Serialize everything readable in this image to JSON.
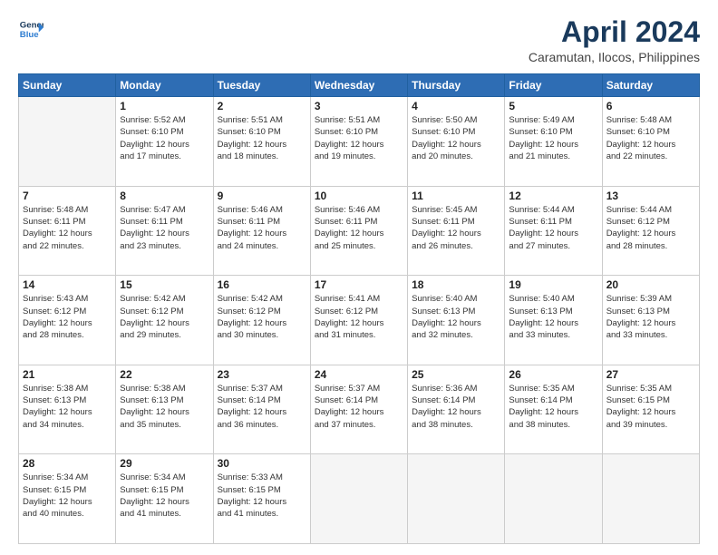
{
  "logo": {
    "line1": "General",
    "line2": "Blue"
  },
  "title": "April 2024",
  "location": "Caramutan, Ilocos, Philippines",
  "days_header": [
    "Sunday",
    "Monday",
    "Tuesday",
    "Wednesday",
    "Thursday",
    "Friday",
    "Saturday"
  ],
  "weeks": [
    [
      {
        "day": "",
        "info": ""
      },
      {
        "day": "1",
        "info": "Sunrise: 5:52 AM\nSunset: 6:10 PM\nDaylight: 12 hours\nand 17 minutes."
      },
      {
        "day": "2",
        "info": "Sunrise: 5:51 AM\nSunset: 6:10 PM\nDaylight: 12 hours\nand 18 minutes."
      },
      {
        "day": "3",
        "info": "Sunrise: 5:51 AM\nSunset: 6:10 PM\nDaylight: 12 hours\nand 19 minutes."
      },
      {
        "day": "4",
        "info": "Sunrise: 5:50 AM\nSunset: 6:10 PM\nDaylight: 12 hours\nand 20 minutes."
      },
      {
        "day": "5",
        "info": "Sunrise: 5:49 AM\nSunset: 6:10 PM\nDaylight: 12 hours\nand 21 minutes."
      },
      {
        "day": "6",
        "info": "Sunrise: 5:48 AM\nSunset: 6:10 PM\nDaylight: 12 hours\nand 22 minutes."
      }
    ],
    [
      {
        "day": "7",
        "info": "Sunrise: 5:48 AM\nSunset: 6:11 PM\nDaylight: 12 hours\nand 22 minutes."
      },
      {
        "day": "8",
        "info": "Sunrise: 5:47 AM\nSunset: 6:11 PM\nDaylight: 12 hours\nand 23 minutes."
      },
      {
        "day": "9",
        "info": "Sunrise: 5:46 AM\nSunset: 6:11 PM\nDaylight: 12 hours\nand 24 minutes."
      },
      {
        "day": "10",
        "info": "Sunrise: 5:46 AM\nSunset: 6:11 PM\nDaylight: 12 hours\nand 25 minutes."
      },
      {
        "day": "11",
        "info": "Sunrise: 5:45 AM\nSunset: 6:11 PM\nDaylight: 12 hours\nand 26 minutes."
      },
      {
        "day": "12",
        "info": "Sunrise: 5:44 AM\nSunset: 6:11 PM\nDaylight: 12 hours\nand 27 minutes."
      },
      {
        "day": "13",
        "info": "Sunrise: 5:44 AM\nSunset: 6:12 PM\nDaylight: 12 hours\nand 28 minutes."
      }
    ],
    [
      {
        "day": "14",
        "info": "Sunrise: 5:43 AM\nSunset: 6:12 PM\nDaylight: 12 hours\nand 28 minutes."
      },
      {
        "day": "15",
        "info": "Sunrise: 5:42 AM\nSunset: 6:12 PM\nDaylight: 12 hours\nand 29 minutes."
      },
      {
        "day": "16",
        "info": "Sunrise: 5:42 AM\nSunset: 6:12 PM\nDaylight: 12 hours\nand 30 minutes."
      },
      {
        "day": "17",
        "info": "Sunrise: 5:41 AM\nSunset: 6:12 PM\nDaylight: 12 hours\nand 31 minutes."
      },
      {
        "day": "18",
        "info": "Sunrise: 5:40 AM\nSunset: 6:13 PM\nDaylight: 12 hours\nand 32 minutes."
      },
      {
        "day": "19",
        "info": "Sunrise: 5:40 AM\nSunset: 6:13 PM\nDaylight: 12 hours\nand 33 minutes."
      },
      {
        "day": "20",
        "info": "Sunrise: 5:39 AM\nSunset: 6:13 PM\nDaylight: 12 hours\nand 33 minutes."
      }
    ],
    [
      {
        "day": "21",
        "info": "Sunrise: 5:38 AM\nSunset: 6:13 PM\nDaylight: 12 hours\nand 34 minutes."
      },
      {
        "day": "22",
        "info": "Sunrise: 5:38 AM\nSunset: 6:13 PM\nDaylight: 12 hours\nand 35 minutes."
      },
      {
        "day": "23",
        "info": "Sunrise: 5:37 AM\nSunset: 6:14 PM\nDaylight: 12 hours\nand 36 minutes."
      },
      {
        "day": "24",
        "info": "Sunrise: 5:37 AM\nSunset: 6:14 PM\nDaylight: 12 hours\nand 37 minutes."
      },
      {
        "day": "25",
        "info": "Sunrise: 5:36 AM\nSunset: 6:14 PM\nDaylight: 12 hours\nand 38 minutes."
      },
      {
        "day": "26",
        "info": "Sunrise: 5:35 AM\nSunset: 6:14 PM\nDaylight: 12 hours\nand 38 minutes."
      },
      {
        "day": "27",
        "info": "Sunrise: 5:35 AM\nSunset: 6:15 PM\nDaylight: 12 hours\nand 39 minutes."
      }
    ],
    [
      {
        "day": "28",
        "info": "Sunrise: 5:34 AM\nSunset: 6:15 PM\nDaylight: 12 hours\nand 40 minutes."
      },
      {
        "day": "29",
        "info": "Sunrise: 5:34 AM\nSunset: 6:15 PM\nDaylight: 12 hours\nand 41 minutes."
      },
      {
        "day": "30",
        "info": "Sunrise: 5:33 AM\nSunset: 6:15 PM\nDaylight: 12 hours\nand 41 minutes."
      },
      {
        "day": "",
        "info": ""
      },
      {
        "day": "",
        "info": ""
      },
      {
        "day": "",
        "info": ""
      },
      {
        "day": "",
        "info": ""
      }
    ]
  ]
}
